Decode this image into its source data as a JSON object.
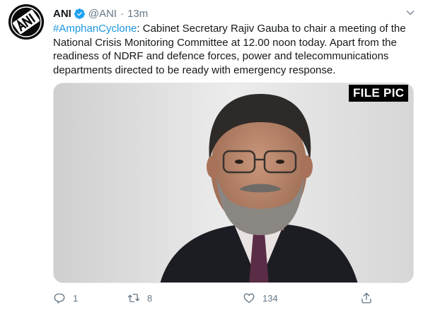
{
  "tweet": {
    "author_name": "ANI",
    "handle": "@ANI",
    "separator": "·",
    "time": "13m",
    "hashtag": "#AmphanCyclone",
    "text": ": Cabinet Secretary Rajiv Gauba to chair a meeting of the National Crisis Monitoring Committee at 12.00 noon today. Apart from the readiness of NDRF and defence forces, power and telecommunications departments directed to be ready with emergency response.",
    "media_overlay_label": "FILE PIC"
  },
  "actions": {
    "reply_count": "1",
    "retweet_count": "8",
    "like_count": "134"
  },
  "icons": {
    "avatar": "ani-logo-avatar",
    "verified": "verified-badge-icon",
    "caret": "chevron-down-icon",
    "reply": "reply-icon",
    "retweet": "retweet-icon",
    "like": "heart-icon",
    "share": "share-icon"
  },
  "colors": {
    "link": "#1b95e0",
    "verified": "#1da1f2",
    "secondary_text": "#657786",
    "primary_text": "#14171a"
  }
}
